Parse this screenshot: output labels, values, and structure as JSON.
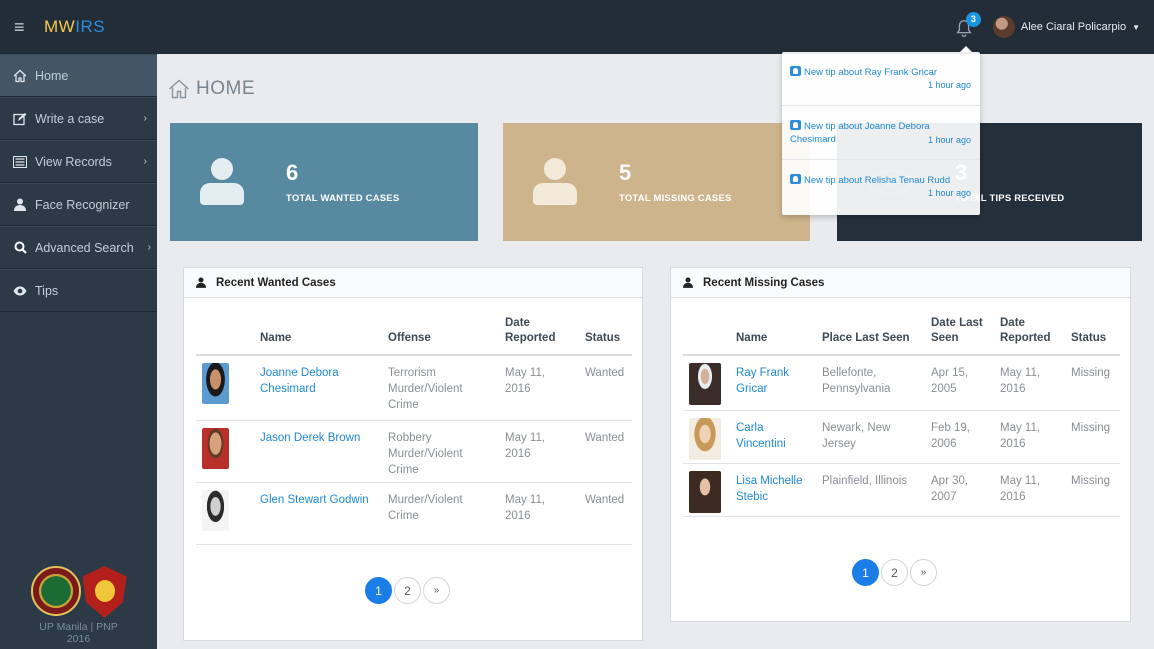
{
  "header": {
    "brand_part1": "MW",
    "brand_part2": "IRS",
    "notification_count": "3",
    "user_name": "Alee Ciaral Policarpio"
  },
  "sidebar": {
    "items": [
      {
        "label": "Home",
        "icon": "home-icon"
      },
      {
        "label": "Write a case",
        "icon": "edit-icon"
      },
      {
        "label": "View Records",
        "icon": "list-icon"
      },
      {
        "label": "Face Recognizer",
        "icon": "user-icon"
      },
      {
        "label": "Advanced Search",
        "icon": "search-icon"
      },
      {
        "label": "Tips",
        "icon": "eye-icon"
      }
    ],
    "footer_line1": "UP Manila | PNP",
    "footer_line2": "2016"
  },
  "page": {
    "title": "HOME"
  },
  "stats": {
    "wanted": {
      "count": "6",
      "label": "TOTAL WANTED CASES"
    },
    "missing": {
      "count": "5",
      "label": "TOTAL MISSING CASES"
    },
    "tips": {
      "count": "3",
      "label": "TOTAL TIPS RECEIVED"
    }
  },
  "wanted_panel": {
    "title": "Recent Wanted Cases",
    "columns": [
      "Name",
      "Offense",
      "Date Reported",
      "Status"
    ],
    "rows": [
      {
        "name": "Joanne Debora Chesimard",
        "offense": "Terrorism Murder/Violent Crime",
        "date": "May 11, 2016",
        "status": "Wanted"
      },
      {
        "name": "Jason Derek Brown",
        "offense": "Robbery Murder/Violent Crime",
        "date": "May 11, 2016",
        "status": "Wanted"
      },
      {
        "name": "Glen Stewart Godwin",
        "offense": "Murder/Violent Crime",
        "date": "May 11, 2016",
        "status": "Wanted"
      }
    ],
    "pages": [
      "1",
      "2",
      "»"
    ]
  },
  "missing_panel": {
    "title": "Recent Missing Cases",
    "columns": [
      "Name",
      "Place Last Seen",
      "Date Last Seen",
      "Date Reported",
      "Status"
    ],
    "rows": [
      {
        "name": "Ray Frank Gricar",
        "place": "Bellefonte, Pennsylvania",
        "last_seen": "Apr 15, 2005",
        "date": "May 11, 2016",
        "status": "Missing"
      },
      {
        "name": "Carla Vincentini",
        "place": "Newark, New Jersey",
        "last_seen": "Feb 19, 2006",
        "date": "May 11, 2016",
        "status": "Missing"
      },
      {
        "name": "Lisa Michelle Stebic",
        "place": "Plainfield, Illinois",
        "last_seen": "Apr 30, 2007",
        "date": "May 11, 2016",
        "status": "Missing"
      }
    ],
    "pages": [
      "1",
      "2",
      "»"
    ]
  },
  "notifications": [
    {
      "text": "New tip about Ray Frank Gricar",
      "time": "1 hour ago"
    },
    {
      "text": "New tip about Joanne Debora Chesimard",
      "time": "1 hour ago"
    },
    {
      "text": "New tip about Relisha Tenau Rudd",
      "time": "1 hour ago"
    }
  ]
}
